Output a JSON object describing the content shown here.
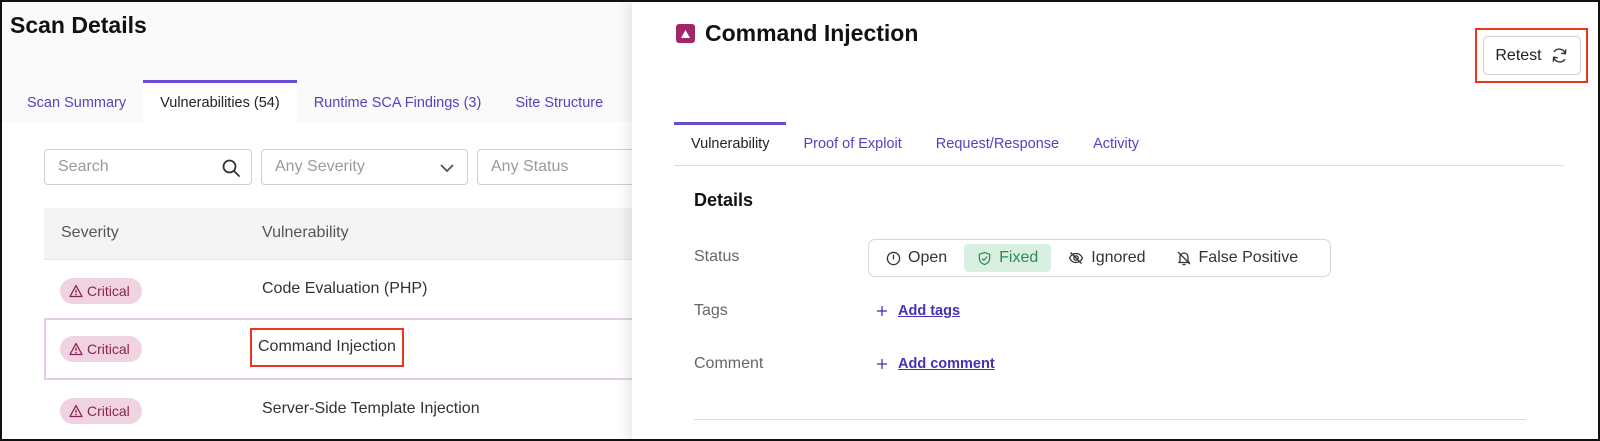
{
  "scan": {
    "page_title": "Scan Details",
    "tabs": [
      {
        "label": "Scan Summary"
      },
      {
        "label": "Vulnerabilities (54)"
      },
      {
        "label": "Runtime SCA Findings (3)"
      },
      {
        "label": "Site Structure"
      }
    ],
    "active_tab": 1,
    "filters": {
      "search_placeholder": "Search",
      "severity_placeholder": "Any Severity",
      "status_placeholder": "Any Status"
    },
    "table": {
      "columns": [
        "Severity",
        "Vulnerability"
      ],
      "rows": [
        {
          "severity": "Critical",
          "vulnerability": "Code Evaluation (PHP)"
        },
        {
          "severity": "Critical",
          "vulnerability": "Command Injection"
        },
        {
          "severity": "Critical",
          "vulnerability": "Server-Side Template Injection"
        }
      ],
      "selected_row": 1
    }
  },
  "detail": {
    "title": "Command Injection",
    "retest_label": "Retest",
    "tabs": [
      {
        "label": "Vulnerability"
      },
      {
        "label": "Proof of Exploit"
      },
      {
        "label": "Request/Response"
      },
      {
        "label": "Activity"
      }
    ],
    "active_tab": 0,
    "section_title": "Details",
    "status_label": "Status",
    "status_options": [
      {
        "label": "Open",
        "icon": "clock-icon"
      },
      {
        "label": "Fixed",
        "icon": "shield-check-icon"
      },
      {
        "label": "Ignored",
        "icon": "eye-off-icon"
      },
      {
        "label": "False Positive",
        "icon": "bell-off-icon"
      }
    ],
    "active_status": "Fixed",
    "tags_label": "Tags",
    "add_tags_label": "Add tags",
    "comment_label": "Comment",
    "add_comment_label": "Add comment"
  },
  "colors": {
    "accent": "#6a4bd6",
    "link": "#5b3fc1",
    "critical_bg": "#f0d3e1",
    "critical_text": "#8a2250",
    "fixed_bg": "#d9f0e1",
    "fixed_text": "#2a8a55",
    "highlight": "#e8361f"
  }
}
